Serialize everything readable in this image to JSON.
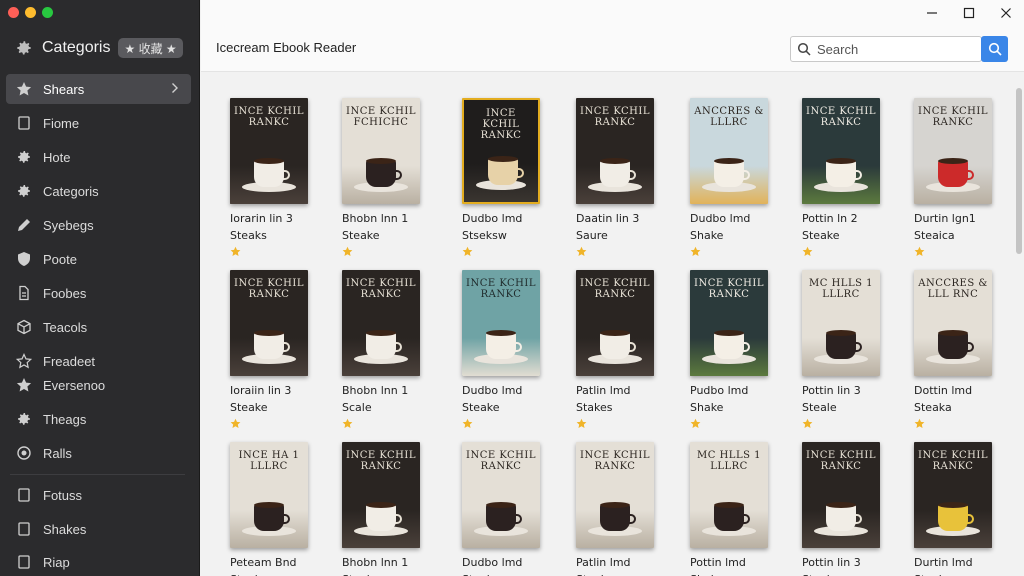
{
  "window": {
    "app_title": "Icecream Ebook Reader"
  },
  "sidebar": {
    "header": {
      "title": "Categoris",
      "badge": "★ 收藏 ★",
      "icon": "gear-icon"
    },
    "items": [
      {
        "label": "Shears",
        "icon": "star-icon",
        "active": true
      },
      {
        "label": "Fiome",
        "icon": "square-icon"
      },
      {
        "label": "Hote",
        "icon": "gear-small-icon"
      },
      {
        "label": "Categoris",
        "icon": "gear-icon"
      },
      {
        "label": "Syebegs",
        "icon": "pen-icon"
      },
      {
        "label": "Poote",
        "icon": "shield-icon"
      },
      {
        "label": "Foobes",
        "icon": "document-icon"
      },
      {
        "label": "Teacols",
        "icon": "cube-icon"
      },
      {
        "label": "Freadeet",
        "icon": "star-outline-icon"
      },
      {
        "label": "Eversenoo",
        "icon": "star-icon"
      },
      {
        "label": "Theags",
        "icon": "gear-icon"
      },
      {
        "label": "Ralls",
        "icon": "circle-icon"
      },
      {
        "label": "Fotuss",
        "icon": "square-icon"
      },
      {
        "label": "Shakes",
        "icon": "square-icon"
      },
      {
        "label": "Riap",
        "icon": "square-icon"
      }
    ]
  },
  "search": {
    "placeholder": "Search",
    "value": ""
  },
  "books": [
    {
      "cover_title": "INCE KCHIL\nRANKC",
      "title": "Iorarin lin 3",
      "subtitle": "Steaks",
      "palette": "dark"
    },
    {
      "cover_title": "INCE KCHIL\nFCHICHC",
      "title": "Bhobn lnn 1",
      "subtitle": "Steake",
      "palette": "light"
    },
    {
      "cover_title": "INCE KCHIL\nRANKC",
      "title": "Dudbo lmd",
      "subtitle": "Stseksw",
      "palette": "gold"
    },
    {
      "cover_title": "INCE KCHIL\nRANKC",
      "title": "Daatin lin 3",
      "subtitle": "Saure",
      "palette": "dark"
    },
    {
      "cover_title": "ANCCRES &\nLLLRC",
      "title": "Dudbo lmd",
      "subtitle": "Shake",
      "palette": "sky"
    },
    {
      "cover_title": "INCE KCHIL\nRANKC",
      "title": "Pottin ln 2",
      "subtitle": "Steake",
      "palette": "green"
    },
    {
      "cover_title": "INCE KCHIL\nRANKC",
      "title": "Durtin lgn1",
      "subtitle": "Steaica",
      "palette": "red"
    },
    {
      "cover_title": "INCE KCHIL\nRANKC",
      "title": "Ioraiin lin 3",
      "subtitle": "Steake",
      "palette": "dark"
    },
    {
      "cover_title": "INCE KCHIL\nRANKC",
      "title": "Bhobn lnn 1",
      "subtitle": "Scale",
      "palette": "dark"
    },
    {
      "cover_title": "INCE KCHIL\nRANKC",
      "title": "Dudbo lmd",
      "subtitle": "Steake",
      "palette": "teal"
    },
    {
      "cover_title": "INCE KCHIL\nRANKC",
      "title": "Patlin lmd",
      "subtitle": "Stakes",
      "palette": "dark"
    },
    {
      "cover_title": "INCE KCHIL\nRANKC",
      "title": "Pudbo lmd",
      "subtitle": "Shake",
      "palette": "green"
    },
    {
      "cover_title": "MC HLLS 1\nLLLRC",
      "title": "Pottin lin 3",
      "subtitle": "Steale",
      "palette": "light"
    },
    {
      "cover_title": "ANCCRES &\nLLL RNC",
      "title": "Dottin lmd",
      "subtitle": "Steaka",
      "palette": "light"
    },
    {
      "cover_title": "INCE HA 1\nLLLRC",
      "title": "Peteam Bnd",
      "subtitle": "Steaksee",
      "palette": "light"
    },
    {
      "cover_title": "INCE KCHIL\nRANKC",
      "title": "Bhobn lnn 1",
      "subtitle": "Steake",
      "palette": "dark"
    },
    {
      "cover_title": "INCE KCHIL\nRANKC",
      "title": "Dudbo lmd",
      "subtitle": "Steake",
      "palette": "light"
    },
    {
      "cover_title": "INCE KCHIL\nRANKC",
      "title": "Patlin lmd",
      "subtitle": "Steake",
      "palette": "light"
    },
    {
      "cover_title": "MC HLLS 1\nLLLRC",
      "title": "Pottin lmd",
      "subtitle": "Shake",
      "palette": "light"
    },
    {
      "cover_title": "INCE KCHIL\nRANKC",
      "title": "Pottin lin 3",
      "subtitle": "Steake",
      "palette": "dark"
    },
    {
      "cover_title": "INCE KCHIL\nRANKC",
      "title": "Durtin lmd",
      "subtitle": "Steake",
      "palette": "yellow"
    }
  ]
}
